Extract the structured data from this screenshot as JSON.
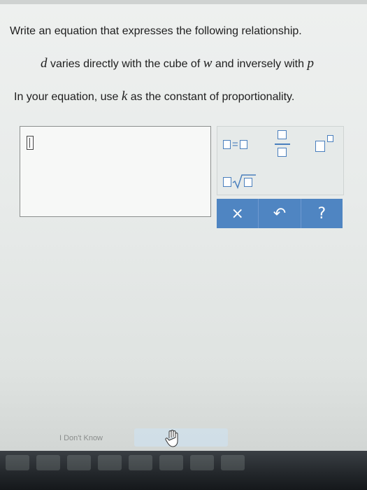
{
  "question": {
    "line1": "Write an equation that expresses the following relationship.",
    "relation": {
      "v1": "d",
      "t1": " varies directly with the cube of ",
      "v2": "w",
      "t2": " and inversely with ",
      "v3": "p"
    },
    "instruction": {
      "t1": "In your equation, use ",
      "v1": "k",
      "t2": " as the constant of proportionality."
    }
  },
  "palette": {
    "equals_symbol": "=",
    "buttons": [
      "equation",
      "fraction",
      "exponent",
      "square-root"
    ]
  },
  "actions": {
    "clear": "×",
    "undo": "↶",
    "help": "?"
  },
  "footer": {
    "dont_know": "I Don't Know"
  },
  "colors": {
    "accent": "#4f85c2",
    "template_box": "#4a7fbd"
  }
}
